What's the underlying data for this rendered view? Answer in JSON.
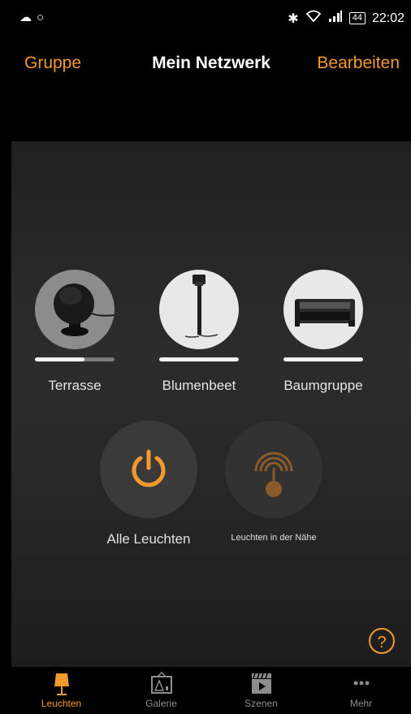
{
  "status": {
    "battery": "44",
    "time": "22:02",
    "icons": [
      "cloud-icon",
      "circle-icon",
      "bluetooth-icon",
      "wifi-icon",
      "signal-icon",
      "battery-icon"
    ]
  },
  "nav": {
    "left": "Gruppe",
    "title": "Mein Netzwerk",
    "right": "Bearbeiten"
  },
  "lamps": [
    {
      "name": "Terrasse",
      "level": 0.62,
      "icon": "spotlight-ball-icon",
      "on": false
    },
    {
      "name": "Blumenbeet",
      "level": 1.0,
      "icon": "garden-spike-icon",
      "on": true
    },
    {
      "name": "Baumgruppe",
      "level": 1.0,
      "icon": "floodlight-icon",
      "on": true
    }
  ],
  "actions": {
    "all_lights": "Alle Leuchten",
    "nearby": "Leuchten in der Nähe"
  },
  "help": "?",
  "tabs": [
    {
      "label": "Leuchten",
      "icon": "lamp-icon",
      "active": true
    },
    {
      "label": "Galerie",
      "icon": "gallery-icon",
      "active": false
    },
    {
      "label": "Szenen",
      "icon": "scene-clapper-icon",
      "active": false
    },
    {
      "label": "Mehr",
      "icon": "more-dots-icon",
      "active": false
    }
  ],
  "colors": {
    "accent": "#f39a2e",
    "background": "#262626",
    "bar": "#000000"
  }
}
